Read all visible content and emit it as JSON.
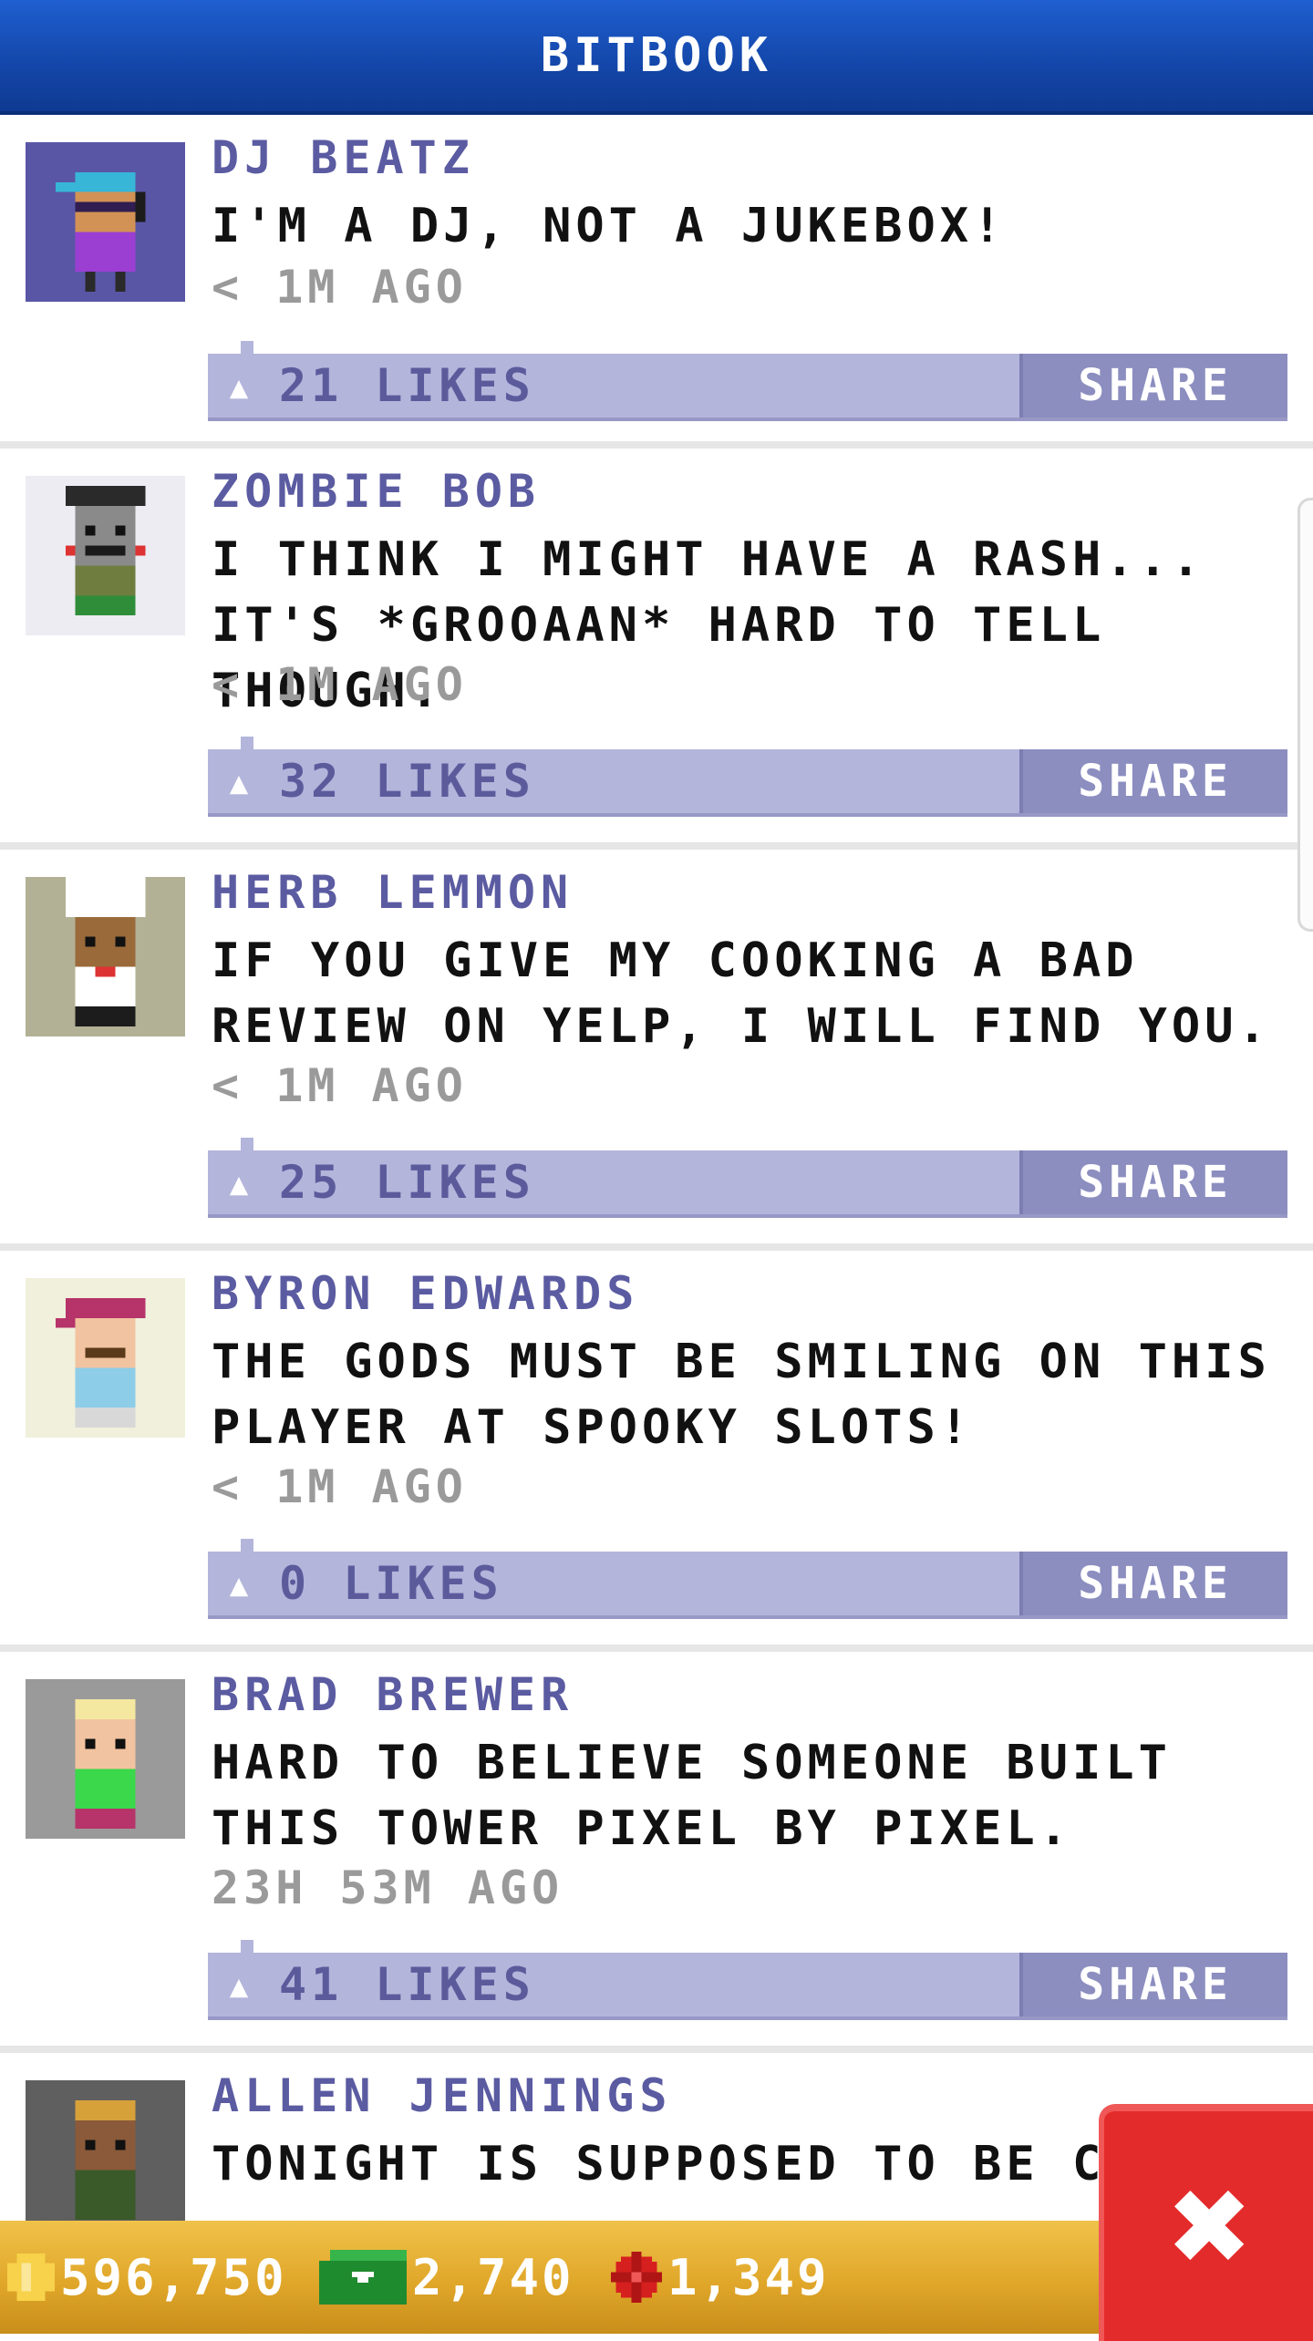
{
  "header": {
    "title": "BITBOOK"
  },
  "posts": [
    {
      "name": "DJ BEATZ",
      "message": "I'M A DJ, NOT A JUKEBOX!",
      "time": "< 1M AGO",
      "likes": "21 LIKES",
      "share": "SHARE",
      "avatar_bg": "#5a56a6"
    },
    {
      "name": "ZOMBIE BOB",
      "message": "I THINK I MIGHT HAVE A RASH... IT'S *GROOAAN* HARD TO TELL THOUGH.",
      "time": "< 1M AGO",
      "likes": "32 LIKES",
      "share": "SHARE",
      "avatar_bg": "#ececf2"
    },
    {
      "name": "HERB LEMMON",
      "message": "IF YOU GIVE MY COOKING A BAD REVIEW ON YELP, I WILL FIND YOU.",
      "time": "< 1M AGO",
      "likes": "25 LIKES",
      "share": "SHARE",
      "avatar_bg": "#b3b195"
    },
    {
      "name": "BYRON EDWARDS",
      "message": "THE GODS MUST BE SMILING ON THIS PLAYER AT SPOOKY SLOTS!",
      "time": "< 1M AGO",
      "likes": "0 LIKES",
      "share": "SHARE",
      "avatar_bg": "#f0f0dc"
    },
    {
      "name": "BRAD BREWER",
      "message": "HARD TO BELIEVE SOMEONE BUILT THIS TOWER PIXEL BY PIXEL.",
      "time": "23H 53M AGO",
      "likes": "41 LIKES",
      "share": "SHARE",
      "avatar_bg": "#9a9a9a"
    },
    {
      "name": "ALLEN JENNINGS",
      "message": "TONIGHT IS SUPPOSED TO BE CLO",
      "avatar_bg": "#5f5f5f"
    }
  ],
  "footer": {
    "coins": "596,750",
    "bux": "2,740",
    "third": "1,349"
  },
  "icons": {
    "like": "like-icon",
    "coin": "coin-icon",
    "bux": "bux-icon",
    "gear": "gear-icon",
    "close": "close-icon"
  },
  "colors": {
    "header": "#1346a8",
    "name": "#5b5ba2",
    "bar": "#b3b5db",
    "share": "#8c8ec0",
    "footer": "#e0a72a",
    "close": "#e42b2b"
  }
}
